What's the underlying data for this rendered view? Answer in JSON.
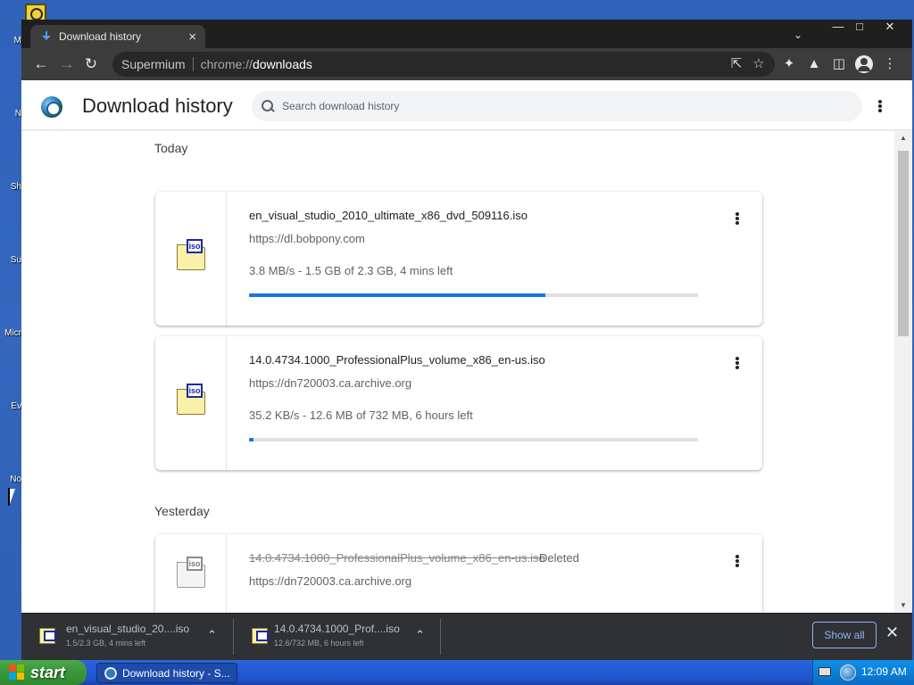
{
  "desktop": {
    "labels": [
      "M",
      "N",
      "Sh",
      "Su",
      "Micr",
      "Ev",
      "No"
    ]
  },
  "browser": {
    "tab": {
      "title": "Download history",
      "close_glyph": "×"
    },
    "toolbar": {
      "site_name": "Supermium",
      "url_scheme": "chrome://",
      "url_host": "downloads"
    }
  },
  "page": {
    "title": "Download history",
    "search_placeholder": "Search download history",
    "sections": [
      {
        "label": "Today"
      },
      {
        "label": "Yesterday"
      }
    ],
    "downloads": [
      {
        "filename": "en_visual_studio_2010_ultimate_x86_dvd_509116.iso",
        "url": "https://dl.bobpony.com",
        "status": "3.8 MB/s - 1.5 GB of 2.3 GB, 4 mins left",
        "progress_percent": 66,
        "icon": "iso-file-icon",
        "icon_badge": "iso"
      },
      {
        "filename": "14.0.4734.1000_ProfessionalPlus_volume_x86_en-us.iso",
        "url": "https://dn720003.ca.archive.org",
        "status": "35.2 KB/s - 12.6 MB of 732 MB, 6 hours left",
        "progress_percent": 1,
        "icon": "iso-file-icon",
        "icon_badge": "iso"
      },
      {
        "filename": "14.0.4734.1000_ProfessionalPlus_volume_x86_en-us.iso",
        "url": "https://dn720003.ca.archive.org",
        "deleted_label": "Deleted",
        "icon": "iso-file-icon",
        "icon_badge": "iso"
      }
    ]
  },
  "shelf": {
    "items": [
      {
        "name": "en_visual_studio_20....iso",
        "status": "1.5/2.3 GB, 4 mins left"
      },
      {
        "name": "14.0.4734.1000_Prof....iso",
        "status": "12.6/732 MB, 6 hours left"
      }
    ],
    "show_all_label": "Show all"
  },
  "taskbar": {
    "start_label": "start",
    "task_label": "Download history - S...",
    "clock": "12:09 AM"
  },
  "colors": {
    "accent": "#1a73e8",
    "taskbar_blue": "#245edb",
    "start_green": "#3b9a3b"
  }
}
